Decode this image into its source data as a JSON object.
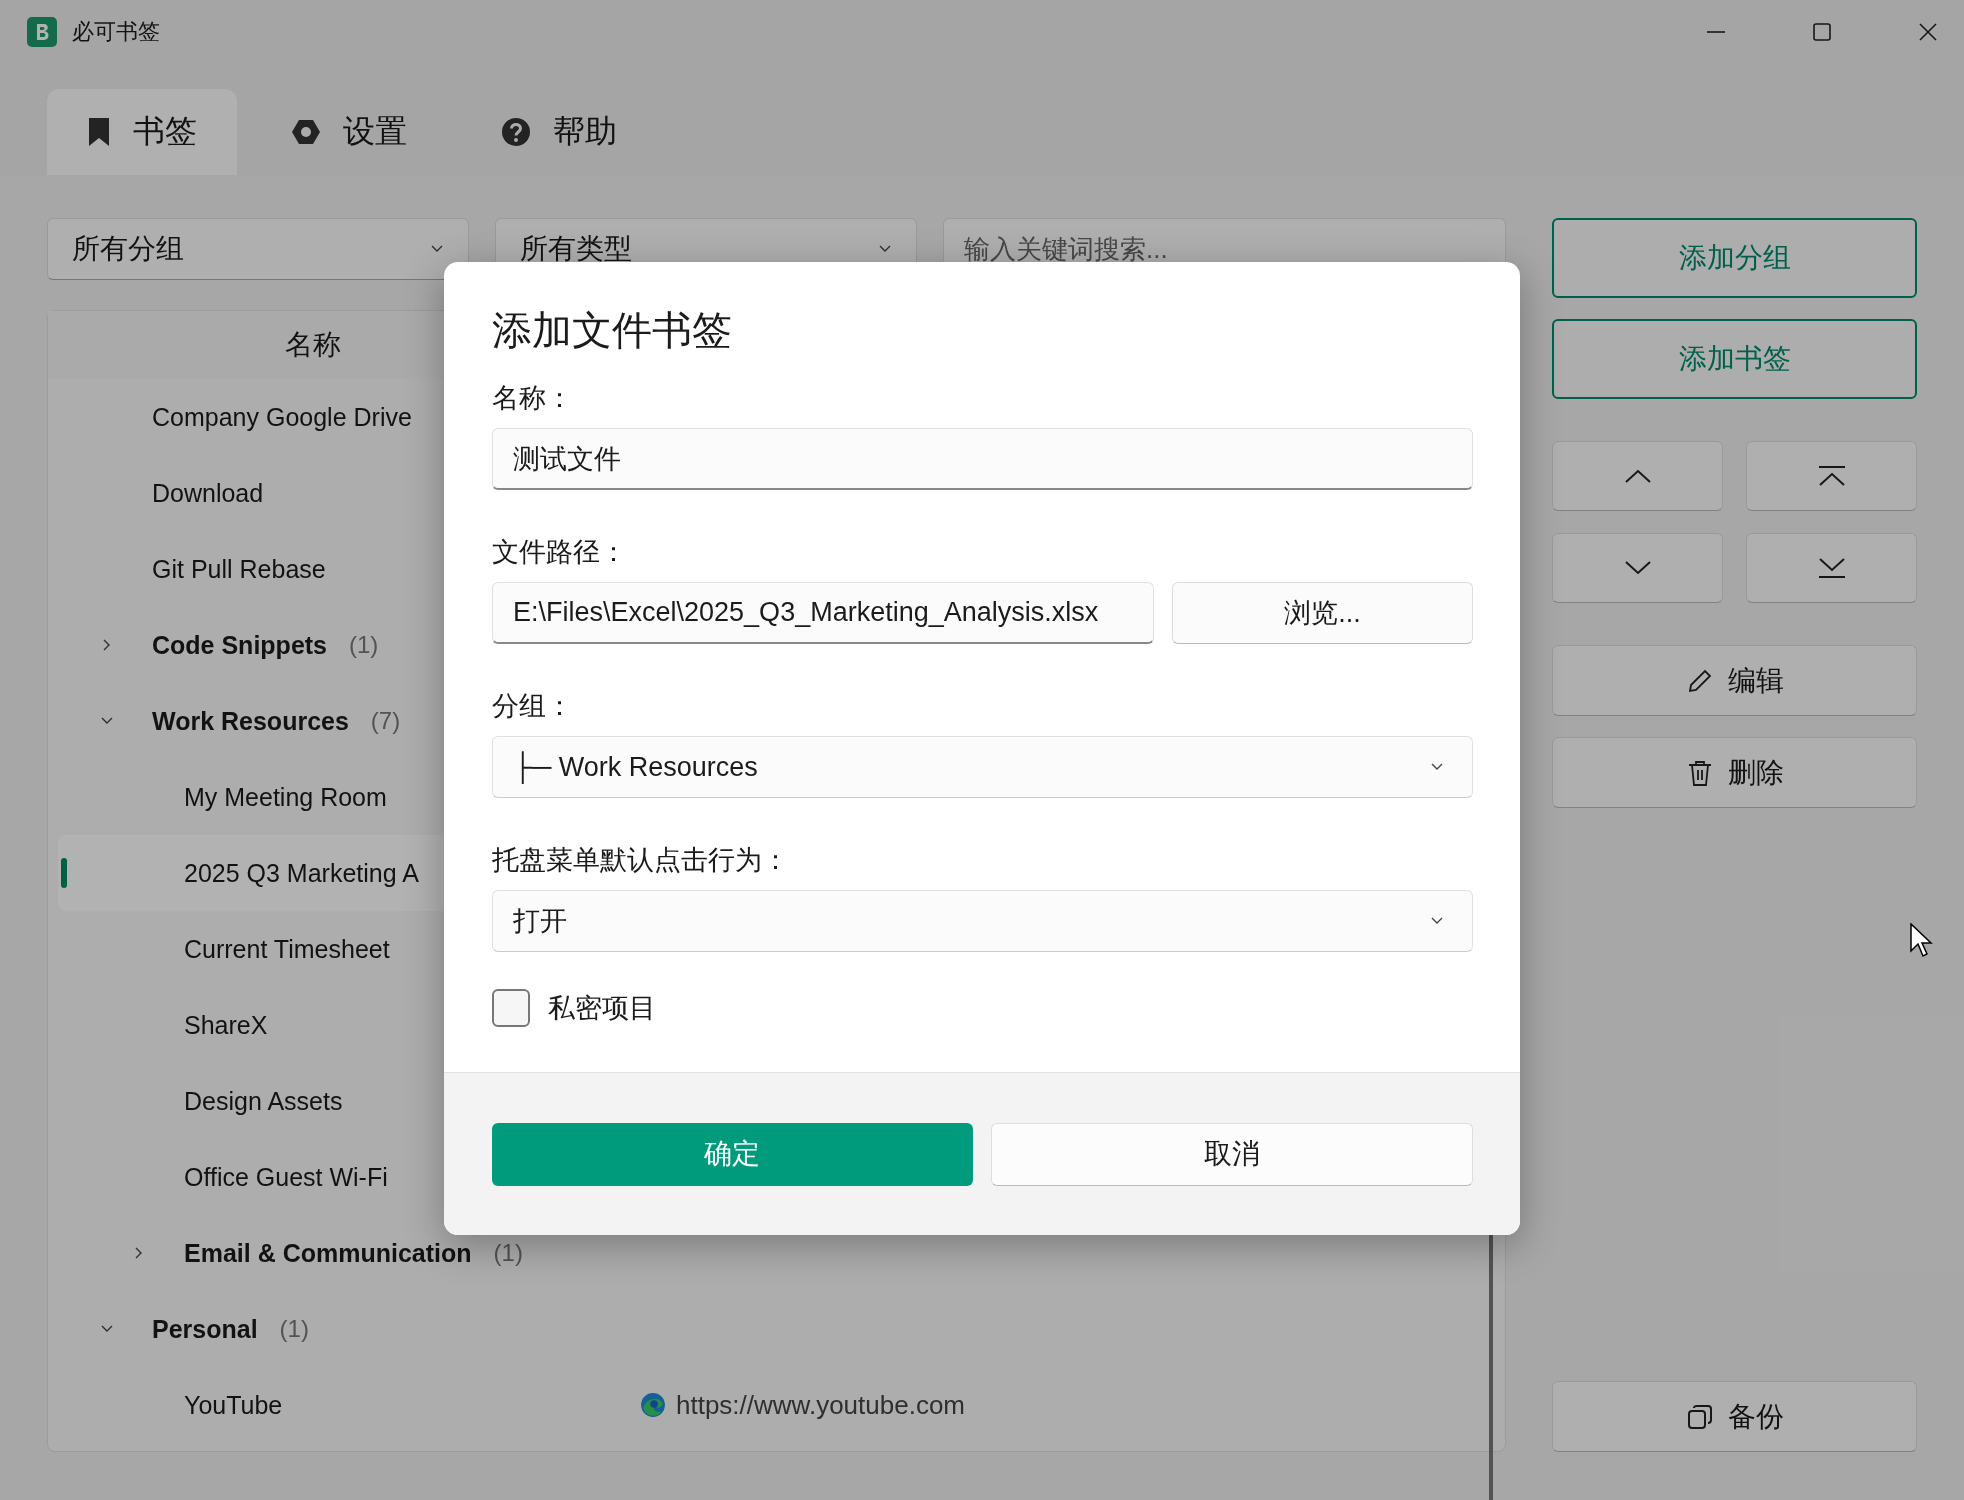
{
  "window": {
    "title": "必可书签"
  },
  "tabs": [
    {
      "label": "书签",
      "selected": true
    },
    {
      "label": "设置",
      "selected": false
    },
    {
      "label": "帮助",
      "selected": false
    }
  ],
  "filters": {
    "group": "所有分组",
    "type": "所有类型",
    "search_placeholder": "输入关键词搜索..."
  },
  "list": {
    "column": "名称",
    "items": [
      {
        "kind": "bookmark",
        "name": "Company Google Drive",
        "selected": false
      },
      {
        "kind": "bookmark",
        "name": "Download",
        "selected": false
      },
      {
        "kind": "bookmark",
        "name": "Git Pull Rebase",
        "selected": false
      },
      {
        "kind": "group",
        "name": "Code Snippets",
        "count": "(1)",
        "expanded": false,
        "selected": false
      },
      {
        "kind": "group",
        "name": "Work Resources",
        "count": "(7)",
        "expanded": true,
        "selected": false,
        "children": [
          {
            "kind": "bookmark",
            "name": "My Meeting Room",
            "selected": false
          },
          {
            "kind": "bookmark",
            "name": "2025 Q3 Marketing A",
            "selected": true
          },
          {
            "kind": "bookmark",
            "name": "Current Timesheet",
            "selected": false
          },
          {
            "kind": "bookmark",
            "name": "ShareX",
            "selected": false
          },
          {
            "kind": "bookmark",
            "name": "Design Assets",
            "selected": false
          },
          {
            "kind": "bookmark",
            "name": "Office Guest Wi-Fi",
            "selected": false
          },
          {
            "kind": "group",
            "name": "Email & Communication",
            "count": "(1)",
            "expanded": false,
            "selected": false
          }
        ]
      },
      {
        "kind": "group",
        "name": "Personal",
        "count": "(1)",
        "expanded": true,
        "selected": false,
        "children": [
          {
            "kind": "bookmark",
            "name": "YouTube",
            "url": "https://www.youtube.com",
            "selected": false
          }
        ]
      }
    ]
  },
  "side_buttons": {
    "add_group": "添加分组",
    "add_bookmark": "添加书签",
    "edit": "编辑",
    "delete": "删除",
    "backup": "备份"
  },
  "dialog": {
    "title": "添加文件书签",
    "name_label": "名称：",
    "name_value": "测试文件",
    "path_label": "文件路径：",
    "path_value": "E:\\Files\\Excel\\2025_Q3_Marketing_Analysis.xlsx",
    "browse": "浏览...",
    "group_label": "分组：",
    "group_value": "├─ Work Resources",
    "tray_label": "托盘菜单默认点击行为：",
    "tray_value": "打开",
    "private_label": "私密项目",
    "private_checked": false,
    "ok": "确定",
    "cancel": "取消"
  }
}
